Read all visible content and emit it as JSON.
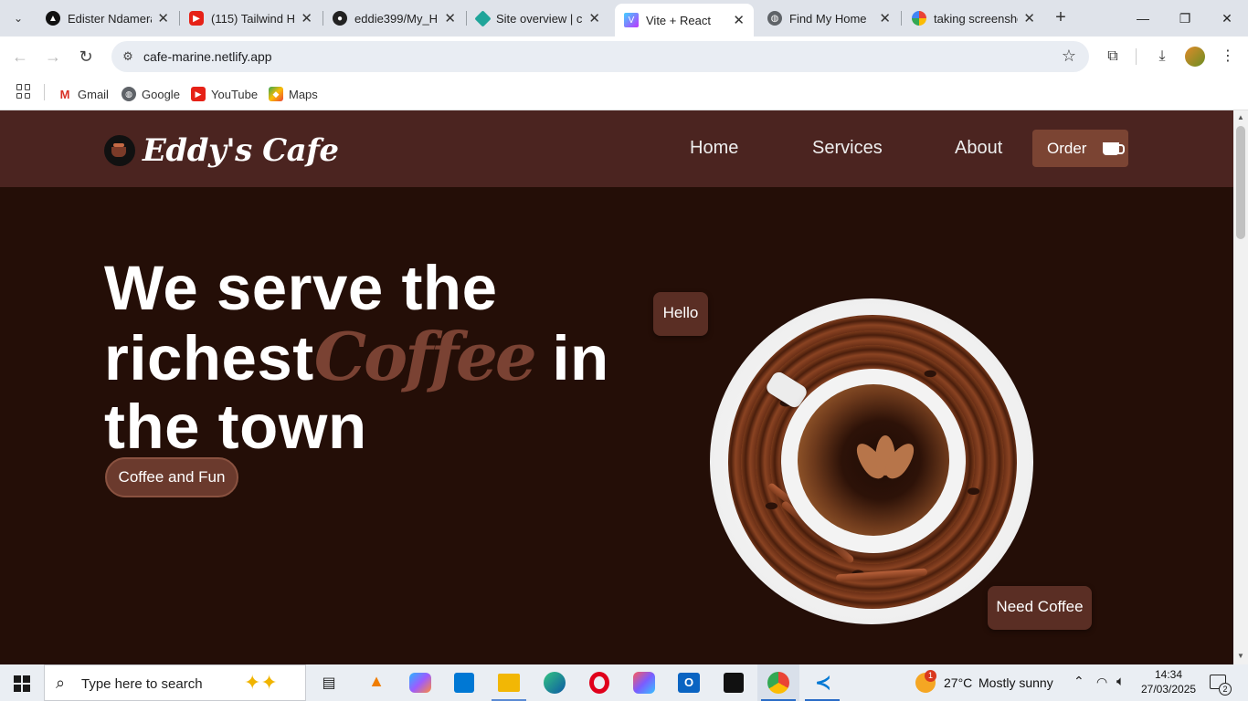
{
  "browser": {
    "tabs": [
      {
        "title": "Edister Ndamera",
        "active": false
      },
      {
        "title": "(115) Tailwind H",
        "active": false
      },
      {
        "title": "eddie399/My_H",
        "active": false
      },
      {
        "title": "Site overview | c",
        "active": false
      },
      {
        "title": "Vite + React",
        "active": true
      },
      {
        "title": "Find My Home",
        "active": false
      },
      {
        "title": "taking screensho",
        "active": false
      }
    ],
    "url": "cafe-marine.netlify.app",
    "bookmarks": [
      {
        "label": "Gmail"
      },
      {
        "label": "Google"
      },
      {
        "label": "YouTube"
      },
      {
        "label": "Maps"
      }
    ]
  },
  "site": {
    "logo_text": "Eddy's Cafe",
    "nav": {
      "home": "Home",
      "services": "Services",
      "about": "About",
      "order": "Order"
    },
    "hero": {
      "line1": "We serve the",
      "line2_prefix": "richest",
      "accent_word": "Coffee",
      "line2_suffix": " in",
      "line3": "the town",
      "badge": "Coffee and Fun"
    },
    "bubbles": {
      "hello": "Hello",
      "need_coffee": "Need Coffee"
    }
  },
  "taskbar": {
    "search_placeholder": "Type here to search",
    "weather_temp": "27°C",
    "weather_desc": "Mostly sunny",
    "time": "14:34",
    "date": "27/03/2025",
    "notification_count": "2",
    "weather_badge": "1"
  },
  "colors": {
    "page_bg": "#240e07",
    "navbar_bg": "#4b2420",
    "accent": "#7a4233",
    "button_bg": "#7b4433"
  }
}
